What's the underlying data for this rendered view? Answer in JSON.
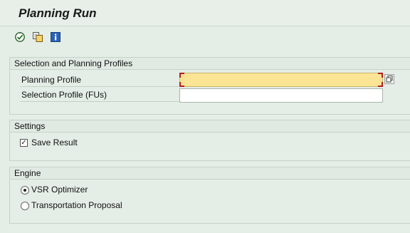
{
  "app": {
    "title": "Planning Run"
  },
  "toolbar": {
    "buttons": [
      {
        "icon": "execute-icon"
      },
      {
        "icon": "variant-icon"
      },
      {
        "icon": "info-icon"
      }
    ]
  },
  "groups": {
    "profiles": {
      "header": "Selection and Planning Profiles",
      "planning_profile_label": "Planning Profile",
      "planning_profile_value": "",
      "selection_profile_label": "Selection Profile (FUs)",
      "selection_profile_value": ""
    },
    "settings": {
      "header": "Settings",
      "save_result_label": "Save Result",
      "save_result_checked": true
    },
    "engine": {
      "header": "Engine",
      "options": [
        {
          "label": "VSR Optimizer",
          "selected": true
        },
        {
          "label": "Transportation Proposal",
          "selected": false
        }
      ]
    }
  },
  "colors": {
    "background": "#e4ede6",
    "required_field": "#fbe493",
    "required_marker": "#b12020"
  }
}
